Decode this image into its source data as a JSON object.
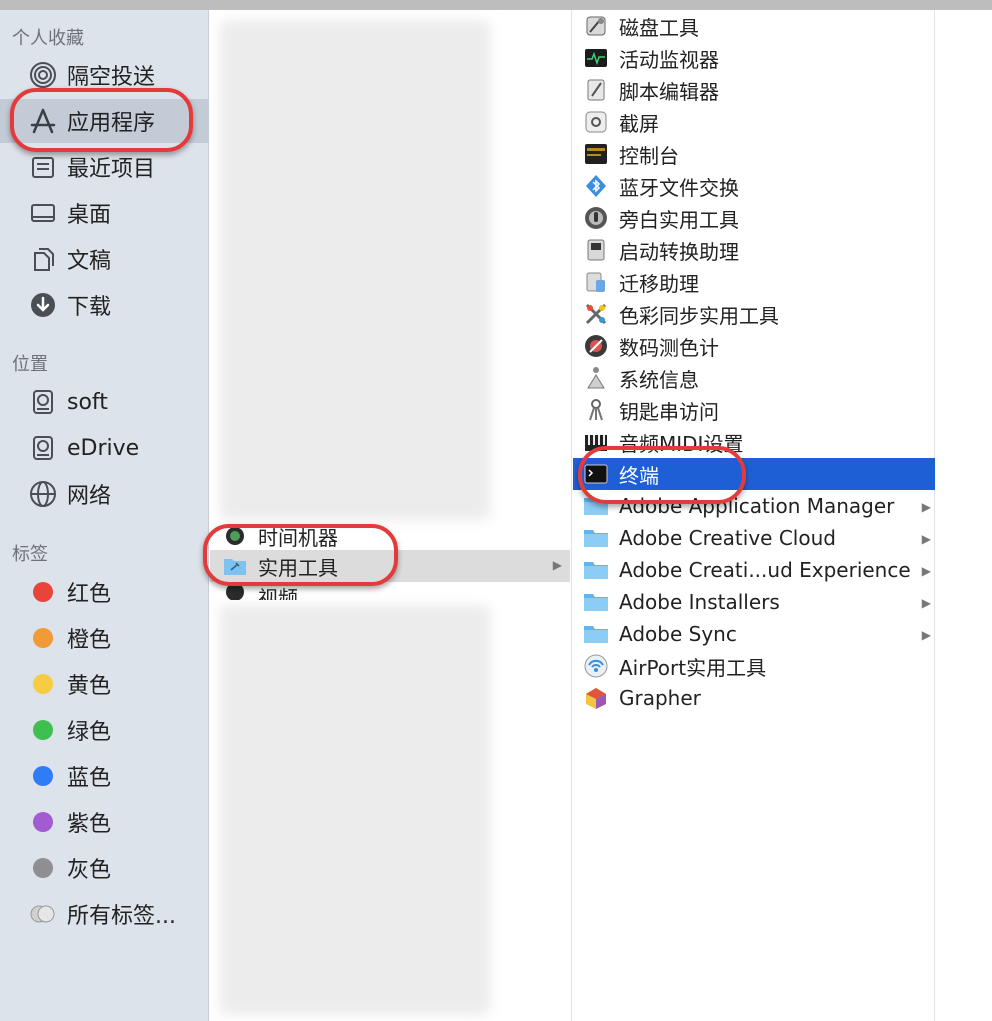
{
  "sidebar": {
    "favorites_title": "个人收藏",
    "favorites": [
      {
        "label": "隔空投送",
        "icon": "airdrop-icon"
      },
      {
        "label": "应用程序",
        "icon": "applications-icon",
        "selected": true
      },
      {
        "label": "最近项目",
        "icon": "recents-icon"
      },
      {
        "label": "桌面",
        "icon": "desktop-icon"
      },
      {
        "label": "文稿",
        "icon": "documents-icon"
      },
      {
        "label": "下载",
        "icon": "downloads-icon"
      }
    ],
    "locations_title": "位置",
    "locations": [
      {
        "label": "soft",
        "icon": "disk-icon"
      },
      {
        "label": "eDrive",
        "icon": "disk-icon"
      },
      {
        "label": "网络",
        "icon": "network-icon"
      }
    ],
    "tags_title": "标签",
    "tags": [
      {
        "label": "红色",
        "color": "#e8443a"
      },
      {
        "label": "橙色",
        "color": "#f19a38"
      },
      {
        "label": "黄色",
        "color": "#f7cc45"
      },
      {
        "label": "绿色",
        "color": "#3fbf4f"
      },
      {
        "label": "蓝色",
        "color": "#2f7cf6"
      },
      {
        "label": "紫色",
        "color": "#a35bd3"
      },
      {
        "label": "灰色",
        "color": "#8e8e93"
      },
      {
        "label": "所有标签...",
        "color": "#c8c8c8"
      }
    ]
  },
  "column2": {
    "items": [
      {
        "label": "时间机器",
        "icon": "time-machine-icon"
      },
      {
        "label": "实用工具",
        "icon": "utilities-folder-icon",
        "selected": true
      },
      {
        "label": "视频",
        "icon": "video-icon"
      }
    ]
  },
  "column3": {
    "items": [
      {
        "label": "磁盘工具",
        "icon": "disk-utility-icon"
      },
      {
        "label": "活动监视器",
        "icon": "activity-monitor-icon"
      },
      {
        "label": "脚本编辑器",
        "icon": "script-editor-icon"
      },
      {
        "label": "截屏",
        "icon": "screenshot-icon"
      },
      {
        "label": "控制台",
        "icon": "console-icon"
      },
      {
        "label": "蓝牙文件交换",
        "icon": "bluetooth-icon"
      },
      {
        "label": "旁白实用工具",
        "icon": "voiceover-icon"
      },
      {
        "label": "启动转换助理",
        "icon": "boot-camp-icon"
      },
      {
        "label": "迁移助理",
        "icon": "migration-icon"
      },
      {
        "label": "色彩同步实用工具",
        "icon": "colorsync-icon"
      },
      {
        "label": "数码测色计",
        "icon": "digital-color-meter-icon"
      },
      {
        "label": "系统信息",
        "icon": "system-info-icon"
      },
      {
        "label": "钥匙串访问",
        "icon": "keychain-icon"
      },
      {
        "label": "音频MIDI设置",
        "icon": "audio-midi-icon"
      },
      {
        "label": "终端",
        "icon": "terminal-icon",
        "selected": true
      },
      {
        "label": "Adobe Application Manager",
        "icon": "folder-icon",
        "folder": true
      },
      {
        "label": "Adobe Creative Cloud",
        "icon": "folder-icon",
        "folder": true
      },
      {
        "label": "Adobe Creati...ud Experience",
        "icon": "folder-icon",
        "folder": true
      },
      {
        "label": "Adobe Installers",
        "icon": "folder-icon",
        "folder": true
      },
      {
        "label": "Adobe Sync",
        "icon": "folder-icon",
        "folder": true
      },
      {
        "label": "AirPort实用工具",
        "icon": "airport-icon"
      },
      {
        "label": "Grapher",
        "icon": "grapher-icon"
      }
    ]
  },
  "colors": {
    "selection_blue": "#1f5fd6",
    "sidebar_bg": "#dde3ea",
    "annotation_red": "#e33b3b",
    "folder_blue": "#5eb6f0"
  }
}
